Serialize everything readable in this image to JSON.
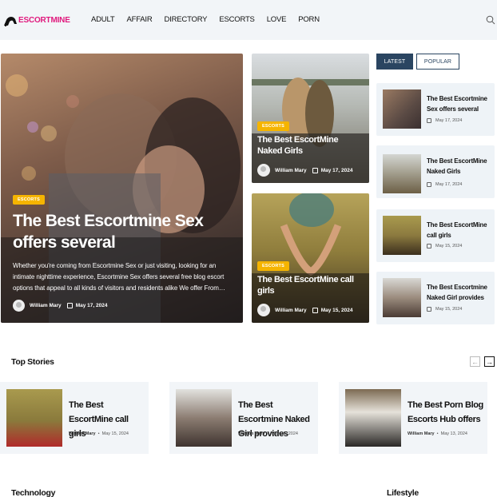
{
  "header": {
    "logo_text": "ESCORTMINE",
    "nav": [
      "ADULT",
      "AFFAIR",
      "DIRECTORY",
      "ESCORTS",
      "LOVE",
      "PORN"
    ]
  },
  "hero": {
    "badge": "ESCORTS",
    "title": "The Best Escortmine Sex offers several",
    "description": "Whether you're coming from Escortmine Sex or just visiting, looking for an intimate nighttime experience, Escortmine Sex offers several free blog escort options that appeal to all kinds of visitors and residents alike We offer From…",
    "author": "William Mary",
    "date": "May 17, 2024"
  },
  "middle_cards": [
    {
      "badge": "ESCORTS",
      "title": "The Best EscortMine Naked Girls",
      "author": "William Mary",
      "date": "May 17, 2024"
    },
    {
      "badge": "ESCORTS",
      "title": "The Best EscortMine call girls",
      "author": "William Mary",
      "date": "May 15, 2024"
    }
  ],
  "tabs": {
    "latest": "LATEST",
    "popular": "POPULAR"
  },
  "sidebar": [
    {
      "title": "The Best Escortmine Sex offers several",
      "date": "May 17, 2024"
    },
    {
      "title": "The Best EscortMine Naked Girls",
      "date": "May 17, 2024"
    },
    {
      "title": "The Best EscortMine call girls",
      "date": "May 15, 2024"
    },
    {
      "title": "The Best Escortmine Naked Girl provides",
      "date": "May 15, 2024"
    }
  ],
  "top_stories": {
    "heading": "Top Stories",
    "items": [
      {
        "title": "The Best EscortMine call girls",
        "author": "William Mary",
        "date": "May 15, 2024"
      },
      {
        "title": "The Best Escortmine Naked Girl provides",
        "author": "William Mary",
        "date": "May 15, 2024"
      },
      {
        "title": "The Best Porn Blog Escorts Hub offers",
        "author": "William Mary",
        "date": "May 13, 2024"
      }
    ]
  },
  "sections": {
    "technology": "Technology",
    "lifestyle": "Lifestyle"
  },
  "colors": {
    "brand": "#e0197d",
    "badge": "#f5b400",
    "tab_active": "#2a4561",
    "panel_bg": "#eef3f7"
  }
}
